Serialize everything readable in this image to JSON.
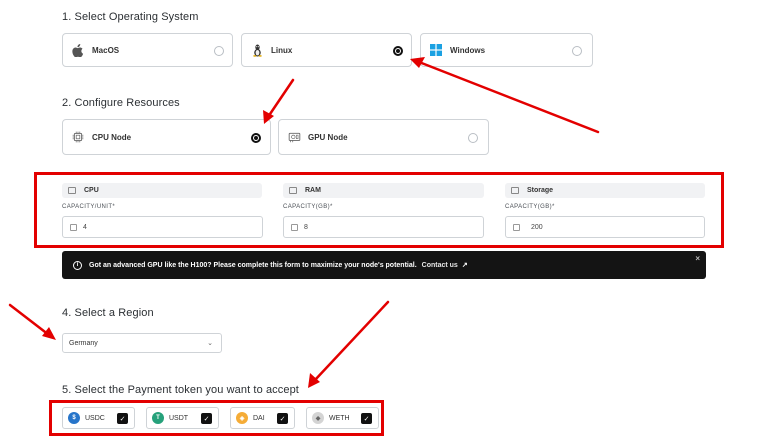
{
  "os": {
    "title": "1. Select Operating System",
    "options": [
      {
        "label": "MacOS",
        "selected": false,
        "icon": "apple-icon"
      },
      {
        "label": "Linux",
        "selected": true,
        "icon": "linux-icon"
      },
      {
        "label": "Windows",
        "selected": false,
        "icon": "windows-icon"
      }
    ]
  },
  "resources": {
    "title": "2. Configure Resources",
    "options": [
      {
        "label": "CPU Node",
        "selected": true,
        "icon": "cpu-icon"
      },
      {
        "label": "GPU Node",
        "selected": false,
        "icon": "gpu-icon"
      }
    ],
    "fields": [
      {
        "header": "CPU",
        "cap_label": "CAPACITY/UNIT*",
        "value": "4"
      },
      {
        "header": "RAM",
        "cap_label": "CAPACITY(GB)*",
        "value": "8"
      },
      {
        "header": "Storage",
        "cap_label": "CAPACITY(GB)*",
        "value": "200"
      }
    ]
  },
  "alert": {
    "text": "Got an advanced GPU like the H100? Please complete this form to maximize your node's potential.",
    "link": "Contact us",
    "close": "×"
  },
  "region": {
    "title": "4. Select a Region",
    "value": "Germany"
  },
  "payment": {
    "title": "5. Select the Payment token you want to accept",
    "tokens": [
      {
        "label": "USDC",
        "checked": true,
        "color": "#2775ca"
      },
      {
        "label": "USDT",
        "checked": true,
        "color": "#26a17b"
      },
      {
        "label": "DAI",
        "checked": true,
        "color": "#f5ac37"
      },
      {
        "label": "WETH",
        "checked": true,
        "color": "#c7c7c7"
      }
    ]
  },
  "annotation_color": "#e30000"
}
